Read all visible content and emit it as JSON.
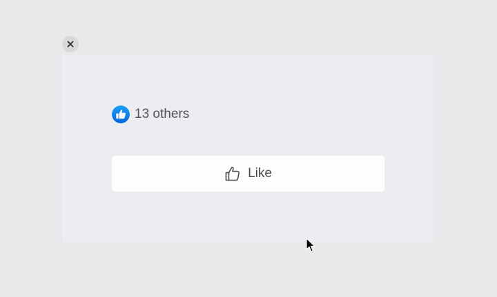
{
  "reactions": {
    "count_text": "13 others",
    "icon": "thumbs-up-icon",
    "badge_color": "#1877f2"
  },
  "like_button": {
    "label": "Like",
    "icon": "thumbs-up-outline-icon"
  },
  "close": {
    "icon": "close-icon"
  },
  "colors": {
    "page_background": "#e9e8ea",
    "panel_background": "#ecedf1",
    "button_background": "#fefdfe",
    "text": "#555458"
  }
}
